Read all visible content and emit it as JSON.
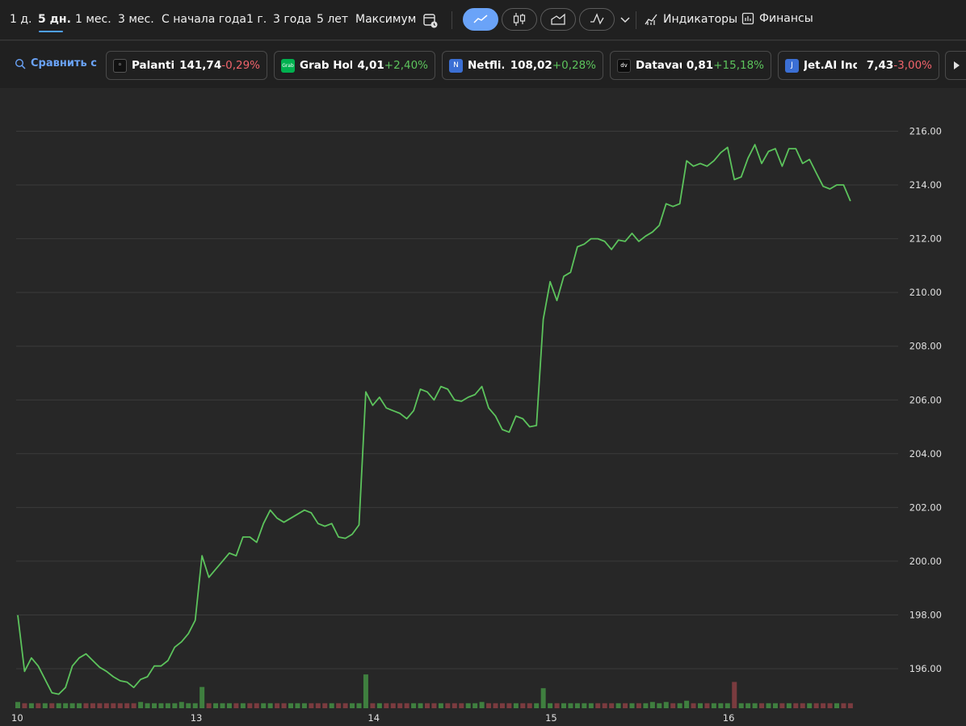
{
  "toolbar": {
    "ranges": [
      "1 д.",
      "5 дн.",
      "1 мес.",
      "3 мес.",
      "С начала года",
      "1 г.",
      "3 года",
      "5 лет",
      "Максимум"
    ],
    "active_range": "5 дн.",
    "indicators_label": "Индикаторы",
    "finance_label": "Финансы"
  },
  "compare": {
    "label": "Сравнить с",
    "tickers": [
      {
        "name": "Palantir...",
        "price": "141,74",
        "change": "-0,29%",
        "direction": "neg",
        "logo_color": "#111111",
        "logo_text": "◦"
      },
      {
        "name": "Grab Hol...",
        "price": "4,01",
        "change": "+2,40%",
        "direction": "pos",
        "logo_color": "#00b14f",
        "logo_text": "Grab"
      },
      {
        "name": "Netfli...",
        "price": "108,02",
        "change": "+0,28%",
        "direction": "pos",
        "logo_color": "#3b6fd4",
        "logo_text": "N"
      },
      {
        "name": "Datavau...",
        "price": "0,81",
        "change": "+15,18%",
        "direction": "pos",
        "logo_color": "#0b0b0b",
        "logo_text": "dv"
      },
      {
        "name": "Jet.AI Inc",
        "price": "7,43",
        "change": "-3,00%",
        "direction": "neg",
        "logo_color": "#3b6fd4",
        "logo_text": "J"
      }
    ]
  },
  "colors": {
    "line": "#5cc35c",
    "volume_up": "#3f7f3f",
    "volume_down": "#7a3b3f",
    "grid": "#3b3b3b",
    "accent": "#6aa3f8"
  },
  "chart_data": {
    "type": "line",
    "title": "",
    "xlabel": "",
    "ylabel": "",
    "ylim": [
      194.6,
      216.8
    ],
    "y_ticks": [
      "216.00",
      "214.00",
      "212.00",
      "210.00",
      "208.00",
      "206.00",
      "204.00",
      "202.00",
      "200.00",
      "198.00",
      "196.00"
    ],
    "y_tick_values": [
      216,
      214,
      212,
      210,
      208,
      206,
      204,
      202,
      200,
      198,
      196
    ],
    "x_ticks": [
      "10",
      "13",
      "14",
      "15",
      "16"
    ],
    "x_tick_index": [
      0,
      26,
      52,
      78,
      104
    ],
    "grid": true,
    "legend": "none",
    "series": [
      {
        "values": [
          197.99,
          195.9,
          196.4,
          196.1,
          195.6,
          195.1,
          195.05,
          195.3,
          196.1,
          196.4,
          196.55,
          196.3,
          196.05,
          195.9,
          195.7,
          195.55,
          195.5,
          195.3,
          195.6,
          195.7,
          196.1,
          196.1,
          196.3,
          196.8,
          197.0,
          197.3,
          197.8,
          200.2,
          199.4,
          199.7,
          200.0,
          200.3,
          200.2,
          200.9,
          200.9,
          200.7,
          201.4,
          201.9,
          201.6,
          201.45,
          201.6,
          201.75,
          201.9,
          201.8,
          201.4,
          201.3,
          201.4,
          200.9,
          200.85,
          201.0,
          201.35,
          206.3,
          205.8,
          206.1,
          205.7,
          205.6,
          205.5,
          205.3,
          205.6,
          206.4,
          206.3,
          206.0,
          206.5,
          206.4,
          206.0,
          205.95,
          206.1,
          206.2,
          206.5,
          205.7,
          205.4,
          204.9,
          204.8,
          205.4,
          205.3,
          205.0,
          205.05,
          209.0,
          210.4,
          209.7,
          210.6,
          210.75,
          211.7,
          211.8,
          212.0,
          212.0,
          211.9,
          211.6,
          211.95,
          211.9,
          212.2,
          211.9,
          212.1,
          212.25,
          212.5,
          213.3,
          213.2,
          213.3,
          214.9,
          214.7,
          214.8,
          214.7,
          214.9,
          215.2,
          215.4,
          214.2,
          214.3,
          215.0,
          215.5,
          214.8,
          215.25,
          215.35,
          214.7,
          215.35,
          215.35,
          214.8,
          214.95,
          214.45,
          213.95,
          213.85,
          214.0,
          214.0,
          213.4
        ]
      }
    ],
    "volume": {
      "values": [
        0.25,
        0.2,
        0.2,
        0.2,
        0.2,
        0.2,
        0.2,
        0.2,
        0.2,
        0.2,
        0.2,
        0.2,
        0.2,
        0.2,
        0.2,
        0.2,
        0.2,
        0.2,
        0.25,
        0.2,
        0.2,
        0.2,
        0.2,
        0.2,
        0.25,
        0.2,
        0.2,
        0.85,
        0.2,
        0.2,
        0.2,
        0.2,
        0.2,
        0.2,
        0.2,
        0.2,
        0.2,
        0.2,
        0.2,
        0.2,
        0.2,
        0.2,
        0.2,
        0.2,
        0.2,
        0.2,
        0.2,
        0.2,
        0.2,
        0.2,
        0.2,
        1.35,
        0.2,
        0.2,
        0.2,
        0.2,
        0.2,
        0.2,
        0.2,
        0.2,
        0.2,
        0.2,
        0.2,
        0.2,
        0.2,
        0.2,
        0.2,
        0.2,
        0.25,
        0.2,
        0.2,
        0.2,
        0.2,
        0.2,
        0.2,
        0.2,
        0.2,
        0.8,
        0.2,
        0.2,
        0.2,
        0.2,
        0.2,
        0.2,
        0.2,
        0.2,
        0.2,
        0.2,
        0.2,
        0.2,
        0.2,
        0.2,
        0.2,
        0.25,
        0.2,
        0.25,
        0.2,
        0.2,
        0.3,
        0.2,
        0.2,
        0.2,
        0.2,
        0.2,
        0.2,
        1.05,
        0.2,
        0.2,
        0.2,
        0.2,
        0.2,
        0.2,
        0.2,
        0.2,
        0.2,
        0.2,
        0.2,
        0.2,
        0.2,
        0.2,
        0.2,
        0.2,
        0.2
      ],
      "direction": [
        "up",
        "down",
        "up",
        "down",
        "up",
        "down",
        "up",
        "up",
        "up",
        "up",
        "down",
        "down",
        "down",
        "down",
        "down",
        "down",
        "down",
        "down",
        "up",
        "up",
        "up",
        "up",
        "up",
        "up",
        "up",
        "up",
        "up",
        "up",
        "down",
        "up",
        "up",
        "up",
        "down",
        "up",
        "down",
        "down",
        "up",
        "up",
        "down",
        "down",
        "up",
        "up",
        "up",
        "down",
        "down",
        "down",
        "up",
        "down",
        "down",
        "up",
        "up",
        "up",
        "down",
        "up",
        "down",
        "down",
        "down",
        "down",
        "up",
        "up",
        "down",
        "down",
        "up",
        "down",
        "down",
        "down",
        "up",
        "up",
        "up",
        "down",
        "down",
        "down",
        "down",
        "up",
        "down",
        "down",
        "up",
        "up",
        "up",
        "down",
        "up",
        "up",
        "up",
        "up",
        "up",
        "down",
        "down",
        "down",
        "up",
        "down",
        "up",
        "down",
        "up",
        "up",
        "up",
        "up",
        "down",
        "up",
        "up",
        "down",
        "up",
        "down",
        "up",
        "up",
        "up",
        "down",
        "up",
        "up",
        "up",
        "down",
        "up",
        "up",
        "down",
        "up",
        "down",
        "down",
        "up",
        "down",
        "down",
        "down",
        "up",
        "down",
        "down"
      ]
    }
  }
}
